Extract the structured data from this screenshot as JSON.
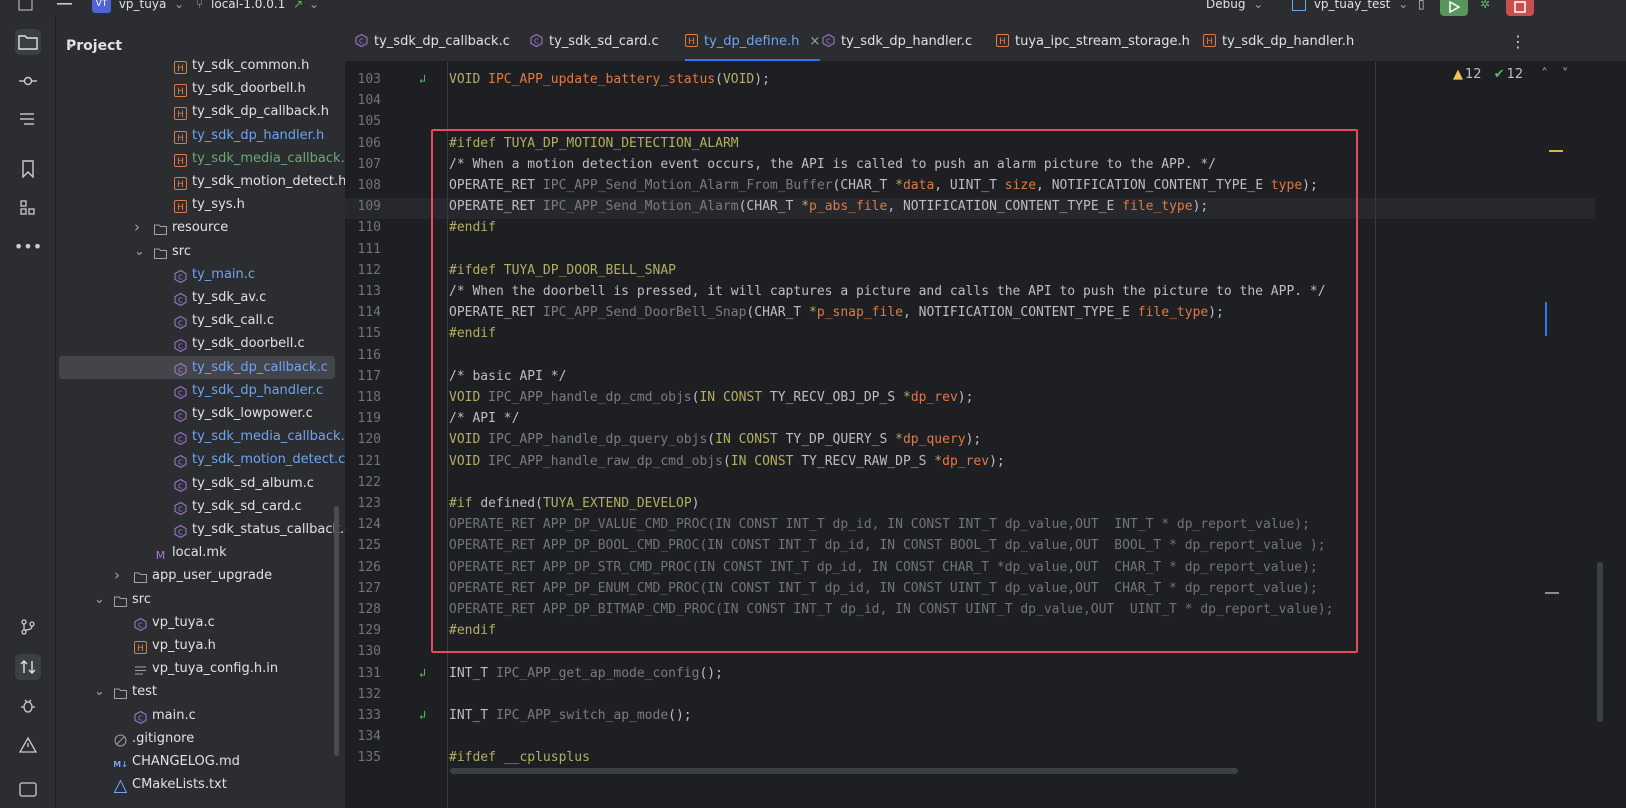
{
  "titlebar": {
    "project_badge": "VT",
    "project_name": "vp_tuya",
    "branch": "local-1.0.0.1",
    "build_config": "Debug",
    "run_target": "vp_tuay_test"
  },
  "project_panel": {
    "title": "Project",
    "rows": [
      {
        "label": "ty_sdk_common.h",
        "icon": "header",
        "color": "normal",
        "indent": 118
      },
      {
        "label": "ty_sdk_doorbell.h",
        "icon": "header",
        "color": "normal",
        "indent": 118
      },
      {
        "label": "ty_sdk_dp_callback.h",
        "icon": "header",
        "color": "normal",
        "indent": 118
      },
      {
        "label": "ty_sdk_dp_handler.h",
        "icon": "header",
        "color": "blue",
        "indent": 118
      },
      {
        "label": "ty_sdk_media_callback.h",
        "icon": "header",
        "color": "green",
        "indent": 118
      },
      {
        "label": "ty_sdk_motion_detect.h",
        "icon": "header",
        "color": "normal",
        "indent": 118
      },
      {
        "label": "ty_sys.h",
        "icon": "header",
        "color": "normal",
        "indent": 118
      },
      {
        "label": "resource",
        "icon": "folder",
        "color": "normal",
        "indent": 98,
        "arrow": "right"
      },
      {
        "label": "src",
        "icon": "folder",
        "color": "normal",
        "indent": 98,
        "arrow": "down"
      },
      {
        "label": "ty_main.c",
        "icon": "csource",
        "color": "blue",
        "indent": 118
      },
      {
        "label": "ty_sdk_av.c",
        "icon": "csource",
        "color": "normal",
        "indent": 118
      },
      {
        "label": "ty_sdk_call.c",
        "icon": "csource",
        "color": "normal",
        "indent": 118
      },
      {
        "label": "ty_sdk_doorbell.c",
        "icon": "csource",
        "color": "normal",
        "indent": 118
      },
      {
        "label": "ty_sdk_dp_callback.c",
        "icon": "csource",
        "color": "blue",
        "indent": 118,
        "selected": true
      },
      {
        "label": "ty_sdk_dp_handler.c",
        "icon": "csource",
        "color": "blue",
        "indent": 118
      },
      {
        "label": "ty_sdk_lowpower.c",
        "icon": "csource",
        "color": "normal",
        "indent": 118
      },
      {
        "label": "ty_sdk_media_callback.c",
        "icon": "csource",
        "color": "blue",
        "indent": 118
      },
      {
        "label": "ty_sdk_motion_detect.c",
        "icon": "csource",
        "color": "blue",
        "indent": 118
      },
      {
        "label": "ty_sdk_sd_album.c",
        "icon": "csource",
        "color": "normal",
        "indent": 118
      },
      {
        "label": "ty_sdk_sd_card.c",
        "icon": "csource",
        "color": "normal",
        "indent": 118
      },
      {
        "label": "ty_sdk_status_callback.c",
        "icon": "csource",
        "color": "normal",
        "indent": 118
      },
      {
        "label": "local.mk",
        "icon": "makefile",
        "color": "normal",
        "indent": 98
      },
      {
        "label": "app_user_upgrade",
        "icon": "folder",
        "color": "normal",
        "indent": 78,
        "arrow": "right"
      },
      {
        "label": "src",
        "icon": "folder",
        "color": "normal",
        "indent": 58,
        "arrow": "down"
      },
      {
        "label": "vp_tuya.c",
        "icon": "csource",
        "color": "normal",
        "indent": 78
      },
      {
        "label": "vp_tuya.h",
        "icon": "header",
        "color": "normal",
        "indent": 78
      },
      {
        "label": "vp_tuya_config.h.in",
        "icon": "text",
        "color": "normal",
        "indent": 78
      },
      {
        "label": "test",
        "icon": "folder",
        "color": "normal",
        "indent": 58,
        "arrow": "down"
      },
      {
        "label": "main.c",
        "icon": "csource",
        "color": "normal",
        "indent": 78
      },
      {
        "label": ".gitignore",
        "icon": "ignore",
        "color": "normal",
        "indent": 58
      },
      {
        "label": "CHANGELOG.md",
        "icon": "markdown",
        "color": "normal",
        "indent": 58
      },
      {
        "label": "CMakeLists.txt",
        "icon": "cmake",
        "color": "normal",
        "indent": 58
      }
    ]
  },
  "tabs": [
    {
      "label": "ty_sdk_dp_callback.c",
      "icon": "csource",
      "active": false
    },
    {
      "label": "ty_sdk_sd_card.c",
      "icon": "csource",
      "active": false
    },
    {
      "label": "ty_dp_define.h",
      "icon": "header",
      "active": true
    },
    {
      "label": "ty_sdk_dp_handler.c",
      "icon": "csource",
      "active": false
    },
    {
      "label": "tuya_ipc_stream_storage.h",
      "icon": "header",
      "active": false
    },
    {
      "label": "ty_sdk_dp_handler.h",
      "icon": "header",
      "active": false
    }
  ],
  "inspections": {
    "warnings": "12",
    "ok": "12"
  },
  "code_lines": [
    {
      "n": "103",
      "mark": "impl",
      "tokens": [
        [
          "VOID ",
          "pp"
        ],
        [
          "IPC_APP_update_battery_status",
          "pr"
        ],
        [
          "(",
          ""
        ],
        [
          "VOID",
          "pp"
        ],
        [
          ");",
          ""
        ]
      ]
    },
    {
      "n": "104",
      "tokens": []
    },
    {
      "n": "105",
      "tokens": []
    },
    {
      "n": "106",
      "tokens": [
        [
          "#ifdef ",
          "pp"
        ],
        [
          "TUYA_DP_MOTION_DETECTION_ALARM",
          "mac"
        ]
      ]
    },
    {
      "n": "107",
      "tokens": [
        [
          "/* When a motion detection event occurs, the API is called to push an alarm picture to the APP. */",
          "cm"
        ]
      ]
    },
    {
      "n": "108",
      "tokens": [
        [
          "OPERATE_RET ",
          ""
        ],
        [
          "IPC_APP_Send_Motion_Alarm_From_Buffer",
          "fnd"
        ],
        [
          "(CHAR_T ",
          ""
        ],
        [
          "*",
          "pp"
        ],
        [
          "data",
          "pr"
        ],
        [
          ", UINT_T ",
          ""
        ],
        [
          "size",
          "pr"
        ],
        [
          ", NOTIFICATION_CONTENT_TYPE_E ",
          ""
        ],
        [
          "type",
          "pr"
        ],
        [
          ");",
          ""
        ]
      ]
    },
    {
      "n": "109",
      "hl": true,
      "tokens": [
        [
          "OPERATE_RET ",
          ""
        ],
        [
          "IPC_APP_Send_Motion_Alarm",
          "fnd"
        ],
        [
          "(CHAR_T ",
          ""
        ],
        [
          "*",
          "pp"
        ],
        [
          "p_abs_file",
          "pr"
        ],
        [
          ", NOTIFICATION_CONTENT_TYPE_E ",
          ""
        ],
        [
          "file_type",
          "pr"
        ],
        [
          ");",
          ""
        ]
      ]
    },
    {
      "n": "110",
      "tokens": [
        [
          "#endif",
          "pp"
        ]
      ]
    },
    {
      "n": "111",
      "tokens": []
    },
    {
      "n": "112",
      "tokens": [
        [
          "#ifdef ",
          "pp"
        ],
        [
          "TUYA_DP_DOOR_BELL_SNAP",
          "mac"
        ]
      ]
    },
    {
      "n": "113",
      "tokens": [
        [
          "/* When the doorbell is pressed, it will captures a picture and calls the API to push the picture to the APP. */",
          "cm"
        ]
      ]
    },
    {
      "n": "114",
      "tokens": [
        [
          "OPERATE_RET ",
          ""
        ],
        [
          "IPC_APP_Send_DoorBell_Snap",
          "fnd"
        ],
        [
          "(CHAR_T ",
          ""
        ],
        [
          "*",
          "pp"
        ],
        [
          "p_snap_file",
          "pr"
        ],
        [
          ", NOTIFICATION_CONTENT_TYPE_E ",
          ""
        ],
        [
          "file_type",
          "pr"
        ],
        [
          ");",
          ""
        ]
      ]
    },
    {
      "n": "115",
      "tokens": [
        [
          "#endif",
          "pp"
        ]
      ]
    },
    {
      "n": "116",
      "tokens": []
    },
    {
      "n": "117",
      "tokens": [
        [
          "/* basic API */",
          "cm"
        ]
      ]
    },
    {
      "n": "118",
      "tokens": [
        [
          "VOID ",
          "pp"
        ],
        [
          "IPC_APP_handle_dp_cmd_objs",
          "fnd"
        ],
        [
          "(",
          ""
        ],
        [
          "IN CONST ",
          "pp"
        ],
        [
          "TY_RECV_OBJ_DP_S ",
          ""
        ],
        [
          "*",
          "pp"
        ],
        [
          "dp_rev",
          "pr"
        ],
        [
          ");",
          ""
        ]
      ]
    },
    {
      "n": "119",
      "tokens": [
        [
          "/* API */",
          "cm"
        ]
      ]
    },
    {
      "n": "120",
      "tokens": [
        [
          "VOID ",
          "pp"
        ],
        [
          "IPC_APP_handle_dp_query_objs",
          "fnd"
        ],
        [
          "(",
          ""
        ],
        [
          "IN CONST ",
          "pp"
        ],
        [
          "TY_DP_QUERY_S ",
          ""
        ],
        [
          "*",
          "pp"
        ],
        [
          "dp_query",
          "pr"
        ],
        [
          ");",
          ""
        ]
      ]
    },
    {
      "n": "121",
      "tokens": [
        [
          "VOID ",
          "pp"
        ],
        [
          "IPC_APP_handle_raw_dp_cmd_objs",
          "fnd"
        ],
        [
          "(",
          ""
        ],
        [
          "IN CONST ",
          "pp"
        ],
        [
          "TY_RECV_RAW_DP_S ",
          ""
        ],
        [
          "*",
          "pp"
        ],
        [
          "dp_rev",
          "pr"
        ],
        [
          ");",
          ""
        ]
      ]
    },
    {
      "n": "122",
      "tokens": []
    },
    {
      "n": "123",
      "tokens": [
        [
          "#if ",
          "pp"
        ],
        [
          "defined(",
          ""
        ],
        [
          "TUYA_EXTEND_DEVELOP",
          "mac"
        ],
        [
          ")",
          ""
        ]
      ]
    },
    {
      "n": "124",
      "tokens": [
        [
          "OPERATE_RET APP_DP_VALUE_CMD_PROC(IN CONST INT_T dp_id, IN CONST INT_T dp_value,OUT  INT_T * dp_report_value);",
          "dim"
        ]
      ]
    },
    {
      "n": "125",
      "tokens": [
        [
          "OPERATE_RET APP_DP_BOOL_CMD_PROC(IN CONST INT_T dp_id, IN CONST BOOL_T dp_value,OUT  BOOL_T * dp_report_value );",
          "dim"
        ]
      ]
    },
    {
      "n": "126",
      "tokens": [
        [
          "OPERATE_RET APP_DP_STR_CMD_PROC(IN CONST INT_T dp_id, IN CONST CHAR_T *dp_value,OUT  CHAR_T * dp_report_value);",
          "dim"
        ]
      ]
    },
    {
      "n": "127",
      "tokens": [
        [
          "OPERATE_RET APP_DP_ENUM_CMD_PROC(IN CONST INT_T dp_id, IN CONST UINT_T dp_value,OUT  CHAR_T * dp_report_value);",
          "dim"
        ]
      ]
    },
    {
      "n": "128",
      "tokens": [
        [
          "OPERATE_RET APP_DP_BITMAP_CMD_PROC(IN CONST INT_T dp_id, IN CONST UINT_T dp_value,OUT  UINT_T * dp_report_value);",
          "dim"
        ]
      ]
    },
    {
      "n": "129",
      "tokens": [
        [
          "#endif",
          "pp"
        ]
      ]
    },
    {
      "n": "130",
      "tokens": []
    },
    {
      "n": "131",
      "mark": "impl",
      "tokens": [
        [
          "INT_T ",
          ""
        ],
        [
          "IPC_APP_get_ap_mode_config",
          "fnd"
        ],
        [
          "();",
          ""
        ]
      ]
    },
    {
      "n": "132",
      "tokens": []
    },
    {
      "n": "133",
      "mark": "impl",
      "tokens": [
        [
          "INT_T ",
          ""
        ],
        [
          "IPC_APP_switch_ap_mode",
          "fnd"
        ],
        [
          "();",
          ""
        ]
      ]
    },
    {
      "n": "134",
      "tokens": []
    },
    {
      "n": "135",
      "tokens": [
        [
          "#ifdef ",
          "pp"
        ],
        [
          "__cplusplus",
          "mac"
        ]
      ]
    }
  ],
  "colors": {
    "accent": "#3574f0",
    "highlight_box": "#e54b5b",
    "keyword": "#cf8e6d",
    "preprocessor": "#b3ae60",
    "param": "#e07a42"
  }
}
